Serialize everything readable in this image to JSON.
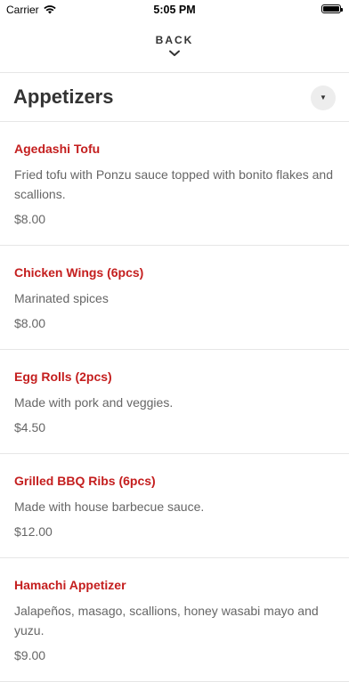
{
  "status_bar": {
    "carrier": "Carrier",
    "time": "5:05 PM"
  },
  "nav": {
    "back_label": "BACK"
  },
  "section": {
    "title": "Appetizers"
  },
  "items": [
    {
      "name": "Agedashi Tofu",
      "description": "Fried tofu with Ponzu sauce topped with bonito flakes and scallions.",
      "price": "$8.00"
    },
    {
      "name": "Chicken Wings (6pcs)",
      "description": "Marinated spices",
      "price": "$8.00"
    },
    {
      "name": "Egg Rolls (2pcs)",
      "description": "Made with pork and veggies.",
      "price": "$4.50"
    },
    {
      "name": "Grilled BBQ Ribs (6pcs)",
      "description": "Made with house barbecue sauce.",
      "price": "$12.00"
    },
    {
      "name": "Hamachi Appetizer",
      "description": "Jalapeños, masago, scallions, honey wasabi mayo and yuzu.",
      "price": "$9.00"
    }
  ],
  "colors": {
    "item_name": "#c41e1e",
    "text_secondary": "#666666",
    "divider": "#e6e6e6"
  }
}
